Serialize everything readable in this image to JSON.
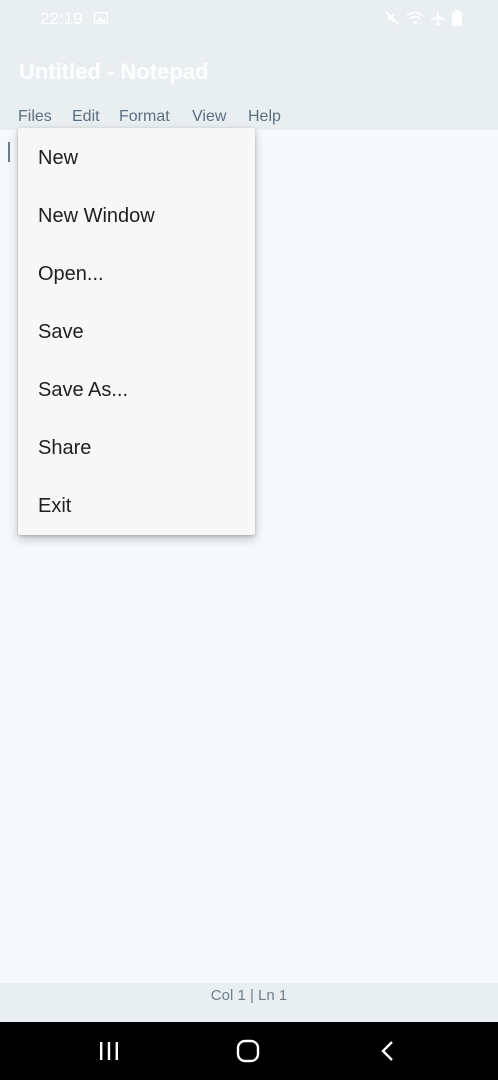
{
  "status_bar": {
    "time": "22:19"
  },
  "window": {
    "title": "Untitled - Notepad"
  },
  "menu": {
    "items": [
      "Files",
      "Edit",
      "Format",
      "View",
      "Help"
    ]
  },
  "files_menu": {
    "items": [
      "New",
      "New Window",
      "Open...",
      "Save",
      "Save As...",
      "Share",
      "Exit"
    ]
  },
  "footer": {
    "cursor_position": "Col 1 | Ln 1"
  },
  "colors": {
    "chrome": "#e9eef1",
    "editor_bg": "#f5f9fb",
    "menu_text": "#5b6f80",
    "dropdown_bg": "#f7f7f7"
  }
}
